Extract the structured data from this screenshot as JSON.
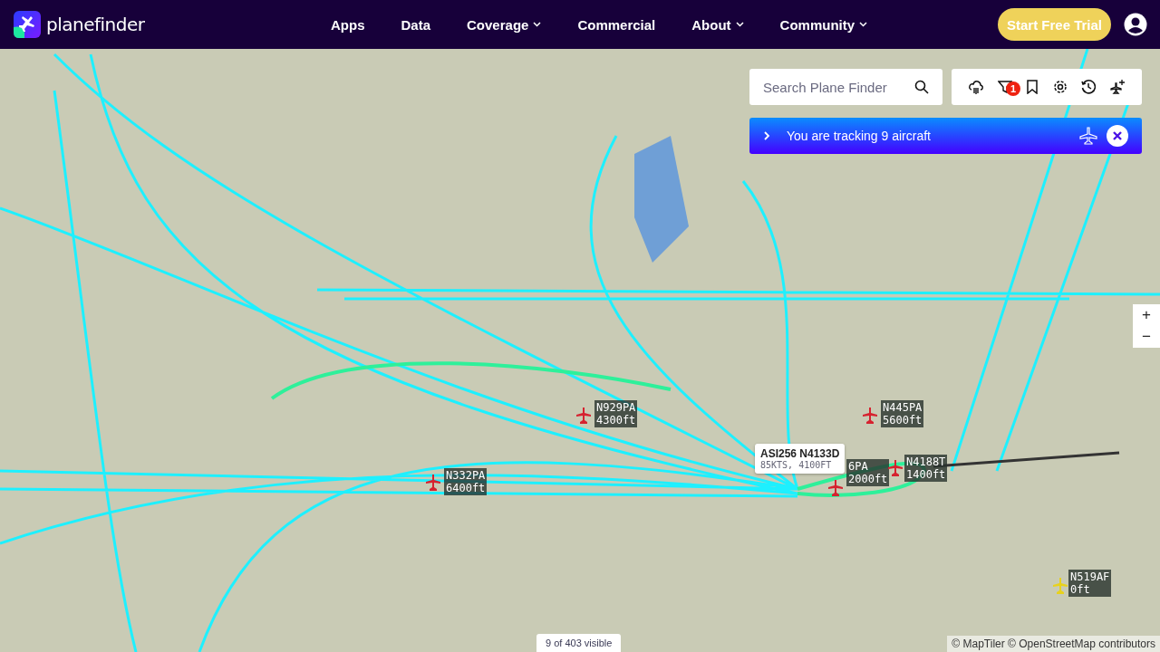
{
  "header": {
    "logo": "planefinder",
    "nav": [
      {
        "label": "Apps",
        "dropdown": false
      },
      {
        "label": "Data",
        "dropdown": false
      },
      {
        "label": "Coverage",
        "dropdown": true
      },
      {
        "label": "Commercial",
        "dropdown": false
      },
      {
        "label": "About",
        "dropdown": true
      },
      {
        "label": "Community",
        "dropdown": true
      }
    ],
    "cta": "Start Free Trial"
  },
  "search": {
    "placeholder": "Search Plane Finder"
  },
  "toolbar": {
    "filter_badge": "1"
  },
  "tracking_banner": {
    "text": "You are tracking 9 aircraft"
  },
  "aircraft": [
    {
      "callsign": "N929PA",
      "altitude": "4300ft",
      "color": "#d6222f"
    },
    {
      "callsign": "N445PA",
      "altitude": "5600ft",
      "color": "#d6222f"
    },
    {
      "callsign": "N332PA",
      "altitude": "6400ft",
      "color": "#d6222f"
    },
    {
      "callsign": "6PA",
      "altitude": "2000ft",
      "color": "#d6222f"
    },
    {
      "callsign": "N4188T",
      "altitude": "1400ft",
      "color": "#d6222f"
    },
    {
      "callsign": "N519AF",
      "altitude": "0ft",
      "color": "#e8d21c"
    }
  ],
  "popup": {
    "title": "ASI256 N4133D",
    "detail": "85KTS, 4100FT"
  },
  "zoom": {
    "in": "+",
    "out": "−"
  },
  "visible_count": "9 of 403 visible",
  "attribution": "© MapTiler © OpenStreetMap contributors"
}
